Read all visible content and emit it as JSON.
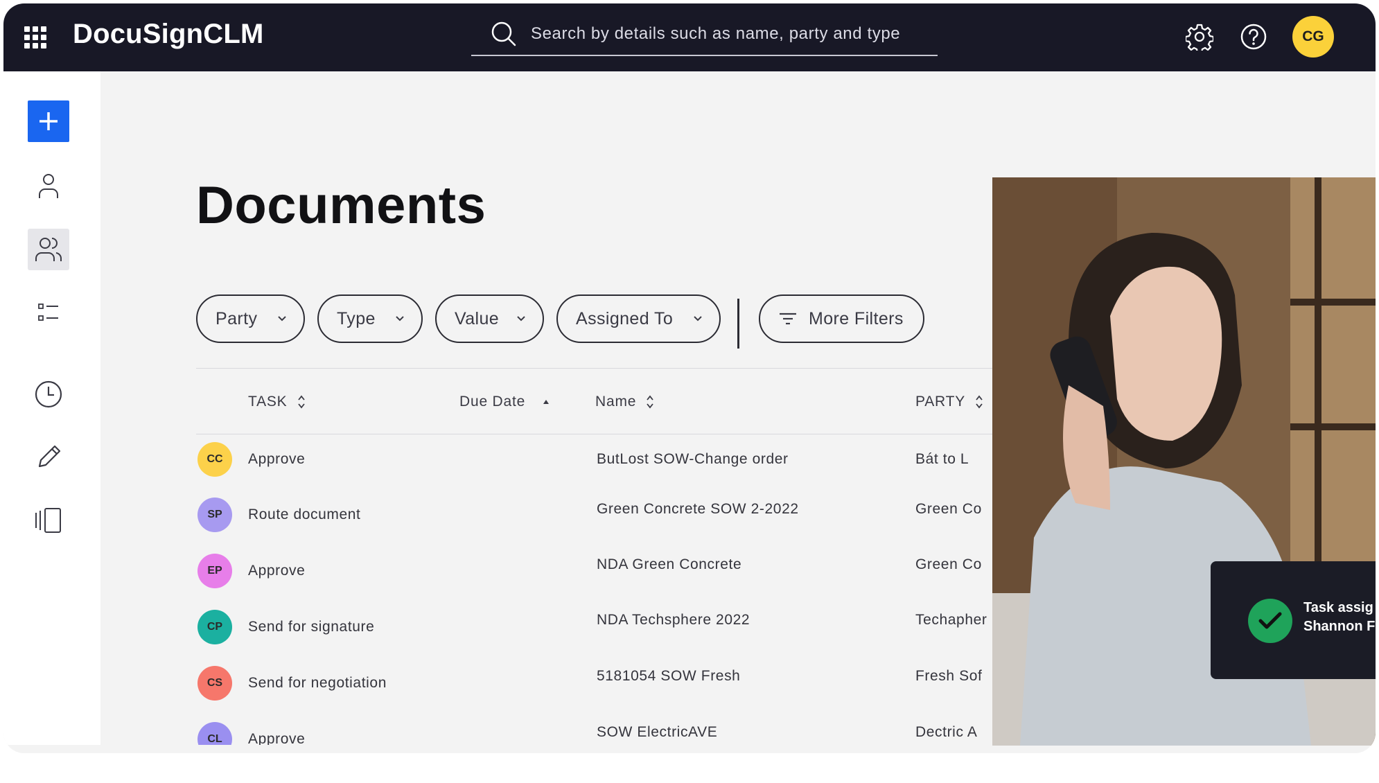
{
  "app": {
    "brand": "DocuSignCLM",
    "user_initials": "CG"
  },
  "search": {
    "placeholder": "Search by details such as name, party and type"
  },
  "page": {
    "title": "Documents"
  },
  "filters": {
    "party": "Party",
    "type": "Type",
    "value": "Value",
    "assigned_to": "Assigned To",
    "more": "More Filters"
  },
  "table": {
    "columns": {
      "task": "TASK",
      "due_date": "Due Date",
      "name": "Name",
      "party": "PARTY"
    },
    "rows": [
      {
        "initials": "CC",
        "color": "#fcd14a",
        "task": "Approve",
        "name": "ButLost SOW-Change order",
        "party": "Bát to L"
      },
      {
        "initials": "SP",
        "color": "#a79af0",
        "task": "Route document",
        "name": "Green Concrete SOW 2-2022",
        "party": "Green Co"
      },
      {
        "initials": "EP",
        "color": "#e77ee9",
        "task": "Approve",
        "name": "NDA Green Concrete",
        "party": "Green Co"
      },
      {
        "initials": "CP",
        "color": "#1bb0a0",
        "task": "Send for signature",
        "name": "NDA Techsphere 2022",
        "party": "Techapher"
      },
      {
        "initials": "CS",
        "color": "#f6776b",
        "task": "Send for negotiation",
        "name": "5181054 SOW Fresh",
        "party": "Fresh Sof"
      },
      {
        "initials": "CL",
        "color": "#9a8ff0",
        "task": "Approve",
        "name": "SOW ElectricAVE",
        "party": "Dectric A"
      }
    ]
  },
  "toast": {
    "line1": "Task assig",
    "line2": "Shannon F"
  },
  "icons": {
    "apps": "apps-grid-icon",
    "search": "search-icon",
    "settings": "gear-icon",
    "help": "help-icon",
    "add": "plus-icon",
    "person": "person-icon",
    "people": "people-icon",
    "list": "list-icon",
    "clock": "clock-icon",
    "pencil": "pencil-icon",
    "panel": "panel-icon"
  },
  "colors": {
    "topbar": "#181826",
    "accent": "#1a66f0",
    "success": "#1fa35a"
  }
}
